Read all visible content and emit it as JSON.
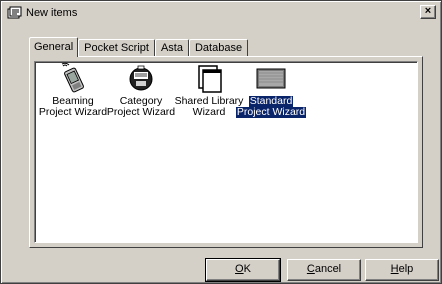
{
  "window": {
    "title": "New items",
    "close_label": "×"
  },
  "tabs": [
    {
      "label": "General",
      "active": true
    },
    {
      "label": "Pocket Script",
      "active": false
    },
    {
      "label": "Asta",
      "active": false
    },
    {
      "label": "Database",
      "active": false
    }
  ],
  "items": [
    {
      "label_line1": "Beaming",
      "label_line2": "Project Wizard",
      "icon": "pda-beam-icon",
      "selected": false
    },
    {
      "label_line1": "Category",
      "label_line2": "Project Wizard",
      "icon": "category-icon",
      "selected": false
    },
    {
      "label_line1": "Shared Library",
      "label_line2": "Wizard",
      "icon": "shared-library-icon",
      "selected": false
    },
    {
      "label_line1": "Standard",
      "label_line2": "Project Wizard",
      "icon": "standard-project-icon",
      "selected": true
    }
  ],
  "buttons": {
    "ok": {
      "mnemonic": "O",
      "rest": "K"
    },
    "cancel": {
      "mnemonic": "C",
      "rest": "ancel"
    },
    "help": {
      "mnemonic": "H",
      "rest": "elp"
    }
  },
  "colors": {
    "face": "#d4d0c8",
    "selection": "#0a246a",
    "selection_text": "#ffffff"
  }
}
